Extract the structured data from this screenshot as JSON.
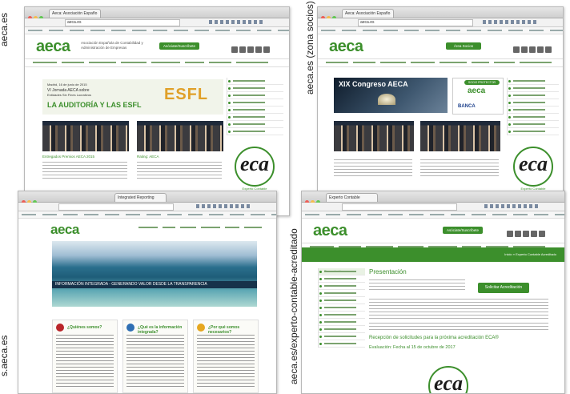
{
  "captions": {
    "top_left": "aeca.es",
    "top_right": "aeca.es (zona socios)",
    "bottom_left": "s.aeca.es",
    "bottom_right": "aeca.es/experto-contable-acreditado"
  },
  "colors": {
    "brand_green": "#3c8f2c",
    "dark_navy": "#16324a"
  },
  "shot1": {
    "tab": "Aeca: Asociación Españo",
    "url": "aeca.es",
    "logo": "aeca",
    "tagline": "Asociación Española de Contabilidad y Administración de Empresas",
    "join_button": "Asóciate/Suscríbete",
    "banner_date": "Madrid, 16 de junio de 2015",
    "banner_lines": [
      "VI Jornada AECA sobre",
      "Entidades Sin Fines Lucrativos"
    ],
    "banner_headline": "LA AUDITORÍA Y LAS ESFL",
    "banner_logo": "ESFL",
    "news_left": "Entregados Premios AECA 2015",
    "news_right": "Rating: AECA",
    "eca_logo": "eca",
    "eca_label": "Experto Contable Acreditado"
  },
  "shot2": {
    "tab": "Aeca: Asociación Españo",
    "url": "aeca.es",
    "logo": "aeca",
    "join_button": "Área Socios",
    "congress_title": "XIX Congreso AECA",
    "ad_logo": "aeca",
    "ad_bank": "BANCA",
    "ad_badge": "SOCIO PROTECTOR",
    "eca_logo": "eca",
    "eca_label": "Experto Contable Acreditado"
  },
  "shot3": {
    "tab": "Integrated Reporting",
    "logo": "aeca",
    "hero_caption": "INFORMACIÓN INTEGRADA - GENERANDO VALOR DESDE LA TRANSPARENCIA",
    "features": [
      "¿Quiénes somos?",
      "¿Qué es la información integrada?",
      "¿Por qué somos necesarios?"
    ]
  },
  "shot4": {
    "tab": "Experto Contable Acreditado",
    "logo": "aeca",
    "join_button": "Asóciate/Suscríbete",
    "breadcrumb": "Inicio » Experto Contable Acreditado",
    "sidebar_active": "Presentación",
    "page_title": "Presentación",
    "cta_button": "Solicitar Acreditación",
    "announcement": "Recepción de solicitudes para la próxima acreditación ECA®",
    "evaluation": "Evaluación: Fecha al 15 de octubre de 2017",
    "eca_logo": "eca"
  }
}
